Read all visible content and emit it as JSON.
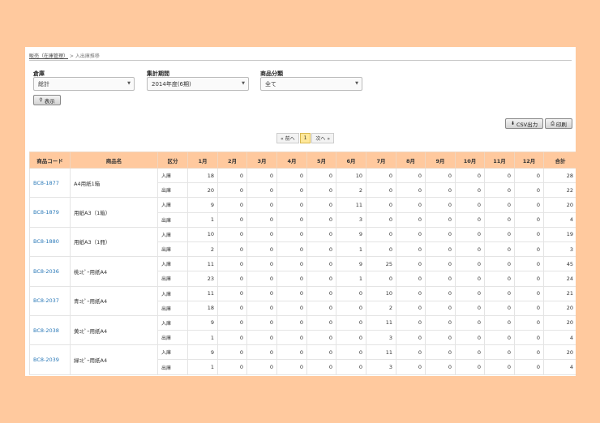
{
  "breadcrumb": {
    "parent": "販売（在庫管理）",
    "separator": " > ",
    "current": "入出庫推移"
  },
  "filters": [
    {
      "label": "倉庫",
      "value": "総計"
    },
    {
      "label": "集計期間",
      "value": "2014年度(6期)"
    },
    {
      "label": "商品分類",
      "value": "全て"
    }
  ],
  "buttons": {
    "show": "表示",
    "csv": "CSV出力",
    "print": "印刷"
  },
  "pager": {
    "prev": "« 前へ",
    "page": "1",
    "next": "次へ »"
  },
  "table": {
    "headers": [
      "商品コード",
      "商品名",
      "区分",
      "1月",
      "2月",
      "3月",
      "4月",
      "5月",
      "6月",
      "7月",
      "8月",
      "9月",
      "10月",
      "11月",
      "12月",
      "合計"
    ],
    "products": [
      {
        "code": "BC8-1877",
        "name": "A4用紙1箱",
        "rows": [
          {
            "kbn": "入庫",
            "v": [
              "18",
              "0",
              "0",
              "0",
              "0",
              "10",
              "0",
              "0",
              "0",
              "0",
              "0",
              "0",
              "28"
            ]
          },
          {
            "kbn": "出庫",
            "v": [
              "20",
              "0",
              "0",
              "0",
              "0",
              "2",
              "0",
              "0",
              "0",
              "0",
              "0",
              "0",
              "22"
            ]
          }
        ]
      },
      {
        "code": "BC8-1879",
        "name": "用紙A3（1箱）",
        "rows": [
          {
            "kbn": "入庫",
            "v": [
              "9",
              "0",
              "0",
              "0",
              "0",
              "11",
              "0",
              "0",
              "0",
              "0",
              "0",
              "0",
              "20"
            ]
          },
          {
            "kbn": "出庫",
            "v": [
              "1",
              "0",
              "0",
              "0",
              "0",
              "3",
              "0",
              "0",
              "0",
              "0",
              "0",
              "0",
              "4"
            ]
          }
        ]
      },
      {
        "code": "BC8-1880",
        "name": "用紙A3（1冊）",
        "rows": [
          {
            "kbn": "入庫",
            "v": [
              "10",
              "0",
              "0",
              "0",
              "0",
              "9",
              "0",
              "0",
              "0",
              "0",
              "0",
              "0",
              "19"
            ]
          },
          {
            "kbn": "出庫",
            "v": [
              "2",
              "0",
              "0",
              "0",
              "0",
              "1",
              "0",
              "0",
              "0",
              "0",
              "0",
              "0",
              "3"
            ]
          }
        ]
      },
      {
        "code": "BC8-2036",
        "name": "桃ｺﾋﾟｰ用紙A4",
        "rows": [
          {
            "kbn": "入庫",
            "v": [
              "11",
              "0",
              "0",
              "0",
              "0",
              "9",
              "25",
              "0",
              "0",
              "0",
              "0",
              "0",
              "45"
            ]
          },
          {
            "kbn": "出庫",
            "v": [
              "23",
              "0",
              "0",
              "0",
              "0",
              "1",
              "0",
              "0",
              "0",
              "0",
              "0",
              "0",
              "24"
            ]
          }
        ]
      },
      {
        "code": "BC8-2037",
        "name": "青ｺﾋﾟｰ用紙A4",
        "rows": [
          {
            "kbn": "入庫",
            "v": [
              "11",
              "0",
              "0",
              "0",
              "0",
              "0",
              "10",
              "0",
              "0",
              "0",
              "0",
              "0",
              "21"
            ]
          },
          {
            "kbn": "出庫",
            "v": [
              "18",
              "0",
              "0",
              "0",
              "0",
              "0",
              "2",
              "0",
              "0",
              "0",
              "0",
              "0",
              "20"
            ]
          }
        ]
      },
      {
        "code": "BC8-2038",
        "name": "黄ｺﾋﾟｰ用紙A4",
        "rows": [
          {
            "kbn": "入庫",
            "v": [
              "9",
              "0",
              "0",
              "0",
              "0",
              "0",
              "11",
              "0",
              "0",
              "0",
              "0",
              "0",
              "20"
            ]
          },
          {
            "kbn": "出庫",
            "v": [
              "1",
              "0",
              "0",
              "0",
              "0",
              "0",
              "3",
              "0",
              "0",
              "0",
              "0",
              "0",
              "4"
            ]
          }
        ]
      },
      {
        "code": "BC8-2039",
        "name": "緑ｺﾋﾟｰ用紙A4",
        "rows": [
          {
            "kbn": "入庫",
            "v": [
              "9",
              "0",
              "0",
              "0",
              "0",
              "0",
              "11",
              "0",
              "0",
              "0",
              "0",
              "0",
              "20"
            ]
          },
          {
            "kbn": "出庫",
            "v": [
              "1",
              "0",
              "0",
              "0",
              "0",
              "0",
              "3",
              "0",
              "0",
              "0",
              "0",
              "0",
              "4"
            ]
          }
        ]
      }
    ]
  },
  "colors": {
    "background": "#ffc99e",
    "header": "#ffc99e",
    "link": "#2a79b8"
  }
}
